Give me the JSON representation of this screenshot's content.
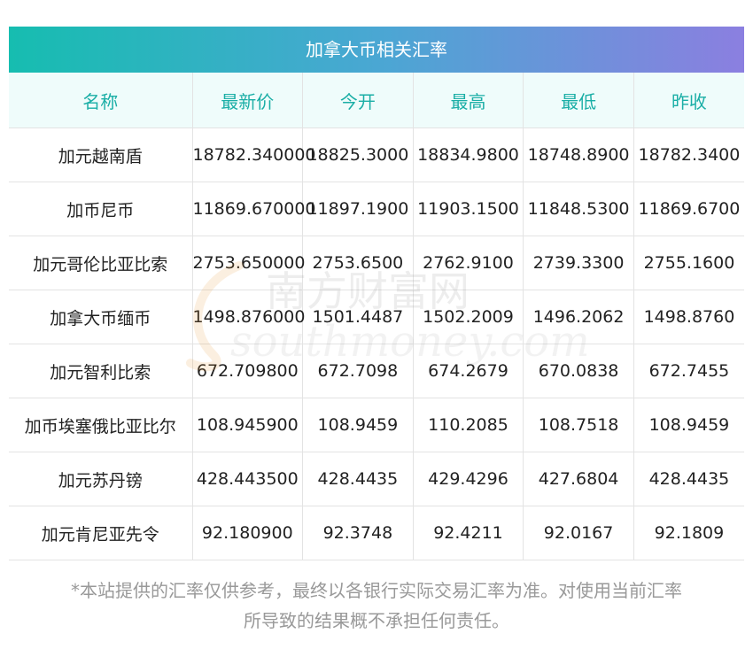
{
  "title": "加拿大币相关汇率",
  "headers": [
    "名称",
    "最新价",
    "今开",
    "最高",
    "最低",
    "昨收"
  ],
  "rows": [
    [
      "加元越南盾",
      "18782.340000",
      "18825.3000",
      "18834.9800",
      "18748.8900",
      "18782.3400"
    ],
    [
      "加币尼币",
      "11869.670000",
      "11897.1900",
      "11903.1500",
      "11848.5300",
      "11869.6700"
    ],
    [
      "加元哥伦比亚比索",
      "2753.650000",
      "2753.6500",
      "2762.9100",
      "2739.3300",
      "2755.1600"
    ],
    [
      "加拿大币缅币",
      "1498.876000",
      "1501.4487",
      "1502.2009",
      "1496.2062",
      "1498.8760"
    ],
    [
      "加元智利比索",
      "672.709800",
      "672.7098",
      "674.2679",
      "670.0838",
      "672.7455"
    ],
    [
      "加币埃塞俄比亚比尔",
      "108.945900",
      "108.9459",
      "110.2085",
      "108.7518",
      "108.9459"
    ],
    [
      "加元苏丹镑",
      "428.443500",
      "428.4435",
      "429.4296",
      "427.6804",
      "428.4435"
    ],
    [
      "加元肯尼亚先令",
      "92.180900",
      "92.3748",
      "92.4211",
      "92.0167",
      "92.1809"
    ]
  ],
  "watermark": {
    "cn": "南方财富网",
    "en": "southmoney.com"
  },
  "footnote": {
    "line1": "*本站提供的汇率仅供参考，最终以各银行实际交易汇率为准。对使用当前汇率",
    "line2": "所导致的结果概不承担任何责任。"
  },
  "colors": {
    "accent": "#1aaea6",
    "header_bg": "#effcfb",
    "gradient_start": "#16bdb0",
    "gradient_end": "#8b7fe0"
  }
}
